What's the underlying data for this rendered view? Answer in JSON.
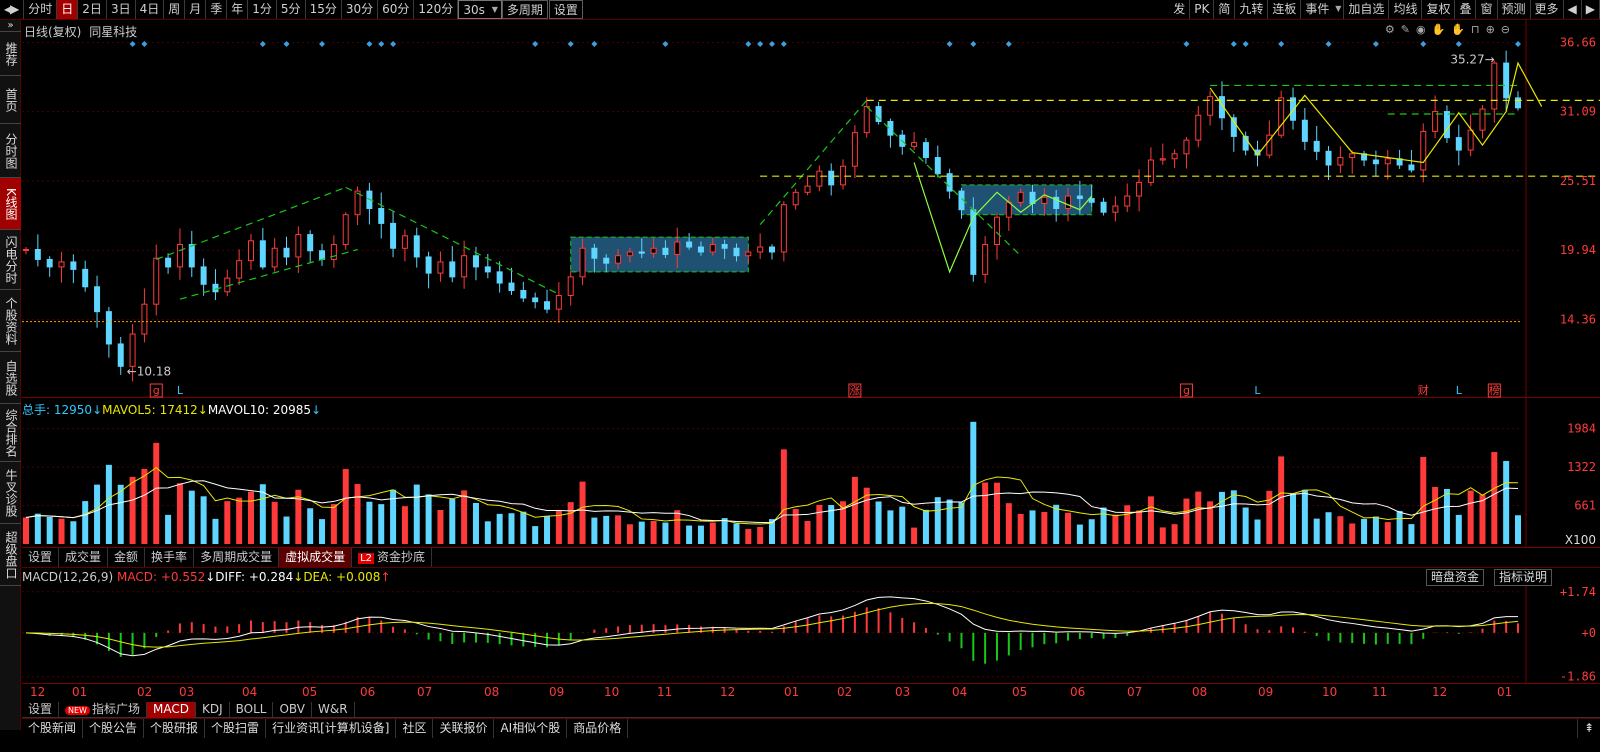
{
  "toolbar": {
    "left": [
      "分时",
      "日",
      "2日",
      "3日",
      "4日",
      "周",
      "月",
      "季",
      "年",
      "1分",
      "5分",
      "15分",
      "30分",
      "60分",
      "120分"
    ],
    "active": "日",
    "select": "30s",
    "extra": [
      "多周期",
      "设置"
    ],
    "right": [
      "发",
      "PK",
      "简",
      "九转",
      "连板",
      "事件",
      "加自选",
      "均线",
      "复权",
      "叠",
      "窗",
      "预测",
      "更多"
    ]
  },
  "sidenav": [
    "推荐",
    "首页",
    "分时图",
    "K线图",
    "闪电分时",
    "个股资料",
    "自选股",
    "综合排名",
    "牛叉诊股",
    "超级盘口"
  ],
  "sidenav_active": "K线图",
  "main": {
    "title": "日线(复权)",
    "stock": "同星科技",
    "price_labels": [
      "36.66",
      "31.09",
      "25.51",
      "19.94",
      "14.36"
    ],
    "low_label": "10.18",
    "high_label": "35.27",
    "event_marks": [
      "g",
      "L",
      "涨",
      "g",
      "L",
      "财",
      "L",
      "榜"
    ]
  },
  "volume": {
    "total_label": "总手:",
    "total": "12950",
    "mavol5_label": "MAVOL5:",
    "mavol5": "17412",
    "mavol10_label": "MAVOL10:",
    "mavol10": "20985",
    "axis_labels": [
      "1984",
      "1322",
      "661",
      "X100"
    ]
  },
  "vol_tabs": [
    "设置",
    "成交量",
    "金额",
    "换手率",
    "多周期成交量",
    "虚拟成交量",
    "资金抄底"
  ],
  "vol_tab_active": "虚拟成交量",
  "vol_tab_badge": "L2",
  "macd": {
    "name": "MACD(12,26,9)",
    "macd_label": "MACD:",
    "macd": "+0.552",
    "diff_label": "DIFF:",
    "diff": "+0.284",
    "dea_label": "DEA:",
    "dea": "+0.008",
    "axis_labels": [
      "+1.74",
      "+0",
      "-1.86"
    ],
    "btn_dark": "暗盘资金",
    "btn_help": "指标说明"
  },
  "x_axis": [
    "12",
    "01",
    "02",
    "03",
    "04",
    "05",
    "06",
    "07",
    "08",
    "09",
    "10",
    "11",
    "12",
    "01",
    "02",
    "03",
    "04",
    "05",
    "06",
    "07",
    "08",
    "09",
    "10",
    "11",
    "12",
    "01"
  ],
  "indicator_tabs": [
    "设置",
    "指标广场",
    "MACD",
    "KDJ",
    "BOLL",
    "OBV",
    "W&R"
  ],
  "indicator_active": "MACD",
  "indicator_new": "NEW",
  "bottom_tabs": [
    "个股新闻",
    "个股公告",
    "个股研报",
    "个股扫雷",
    "行业资讯[计算机设备]",
    "社区",
    "关联报价",
    "AI相似个股",
    "商品价格"
  ],
  "chart_data": [
    {
      "type": "candlestick",
      "title": "日线(复权) 同星科技",
      "x_ticks": [
        "12",
        "01",
        "02",
        "03",
        "04",
        "05",
        "06",
        "07",
        "08",
        "09",
        "10",
        "11",
        "12",
        "01",
        "02",
        "03",
        "04",
        "05",
        "06",
        "07",
        "08",
        "09",
        "10",
        "11",
        "12",
        "01"
      ],
      "price_ticks": [
        36.66,
        31.09,
        25.51,
        19.94,
        14.36
      ],
      "ylim": [
        9.5,
        37.5
      ],
      "low": 10.18,
      "high": 35.27,
      "close_series": [
        20.0,
        19.2,
        18.6,
        19.0,
        18.4,
        17.0,
        15.0,
        12.4,
        10.6,
        13.2,
        15.6,
        19.3,
        18.6,
        20.4,
        18.6,
        17.2,
        16.6,
        17.7,
        19.1,
        20.7,
        18.6,
        20.1,
        19.4,
        21.2,
        19.9,
        19.2,
        20.4,
        22.8,
        24.7,
        23.3,
        22.1,
        20.1,
        21.1,
        19.4,
        18.1,
        19.0,
        17.8,
        19.5,
        18.6,
        18.2,
        17.3,
        16.7,
        16.1,
        15.8,
        15.2,
        16.3,
        17.8,
        20.1,
        19.3,
        18.9,
        19.5,
        19.8,
        19.7,
        20.1,
        19.6,
        20.6,
        20.2,
        19.8,
        20.4,
        20.1,
        19.5,
        19.8,
        20.2,
        19.8,
        23.6,
        24.6,
        25.1,
        26.3,
        25.2,
        26.7,
        29.4,
        31.5,
        30.3,
        29.2,
        28.3,
        28.6,
        27.4,
        26.1,
        24.7,
        23.2,
        18.0,
        20.4,
        22.6,
        23.8,
        24.6,
        23.7,
        24.2,
        23.3,
        24.3,
        24.1,
        23.8,
        23.0,
        23.5,
        24.3,
        25.4,
        27.2,
        27.3,
        27.7,
        28.8,
        30.8,
        32.3,
        30.6,
        29.1,
        28.0,
        27.6,
        29.2,
        32.2,
        30.4,
        28.7,
        27.9,
        26.8,
        27.4,
        27.7,
        27.2,
        26.9,
        27.3,
        26.8,
        26.4,
        29.5,
        31.1,
        29.0,
        28.0,
        29.6,
        31.3,
        35.0,
        32.2,
        31.4
      ]
    },
    {
      "type": "bar",
      "title": "成交量",
      "yticks": [
        1984,
        1322,
        661
      ],
      "unit": "X100",
      "series": [
        {
          "name": "MAVOL5",
          "values": [
            17412
          ]
        },
        {
          "name": "MAVOL10",
          "values": [
            20985
          ]
        }
      ]
    },
    {
      "type": "bar",
      "title": "MACD(12,26,9)",
      "yticks": [
        1.74,
        0,
        -1.86
      ],
      "latest": {
        "MACD": 0.552,
        "DIFF": 0.284,
        "DEA": 0.008
      }
    }
  ],
  "colors": {
    "up": "#ff3a3a",
    "down": "#5ed6ff",
    "dash_green": "#18c818",
    "dash_yellow": "#e8e800",
    "box_fill": "#2a6c99",
    "diamond": "#3aa0e0",
    "support": "#ff9a00",
    "grid": "#4a0000"
  }
}
